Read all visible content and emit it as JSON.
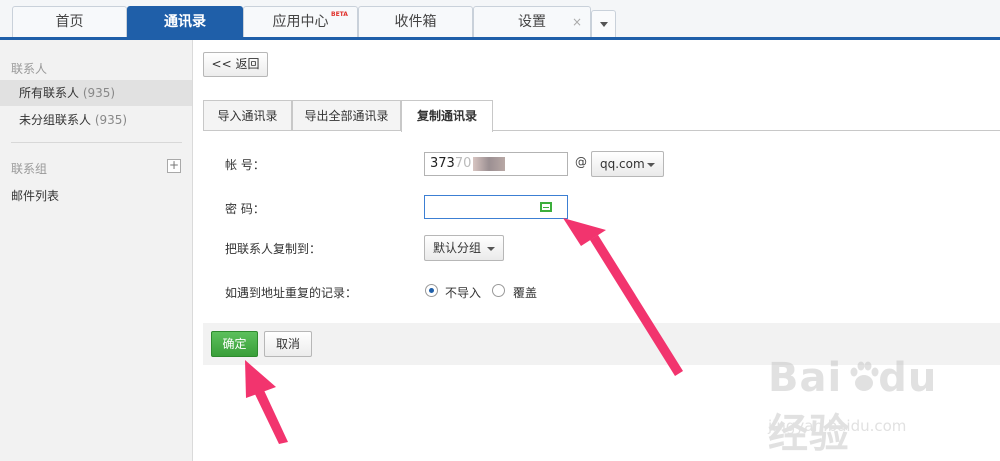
{
  "top_tabs": [
    {
      "label": "首页"
    },
    {
      "label": "通讯录"
    },
    {
      "label": "应用中心",
      "badge": "BETA"
    },
    {
      "label": "收件箱"
    },
    {
      "label": "设置",
      "close": "×"
    }
  ],
  "sidebar": {
    "contacts_heading": "联系人",
    "items": [
      {
        "label": "所有联系人",
        "count": "(935)"
      },
      {
        "label": "未分组联系人",
        "count": "(935)"
      }
    ],
    "groups_heading": "联系组",
    "plus": "+",
    "mail_list": "邮件列表"
  },
  "main": {
    "back_label": "<< 返回",
    "sub_tabs": [
      {
        "label": "导入通讯录"
      },
      {
        "label": "导出全部通讯录"
      },
      {
        "label": "复制通讯录"
      }
    ],
    "form": {
      "account_label": "帐 号：",
      "account_value": "373",
      "account_value_tail": "70",
      "at": "@",
      "domain": "qq.com",
      "password_label": "密 码：",
      "copy_to_label": "把联系人复制到：",
      "copy_to_value": "默认分组",
      "duplicate_label": "如遇到地址重复的记录：",
      "options": [
        {
          "label": "不导入",
          "checked": true
        },
        {
          "label": "覆盖",
          "checked": false
        }
      ]
    },
    "ok_label": "确定",
    "cancel_label": "取消"
  },
  "watermark": {
    "brand": "Bai",
    "brand2": "du",
    "cn": "经验",
    "url": "jingyan.baidu.com"
  },
  "colors": {
    "accent": "#1f5fa9",
    "ok": "#3fa43f",
    "arrow": "#f2346e"
  }
}
